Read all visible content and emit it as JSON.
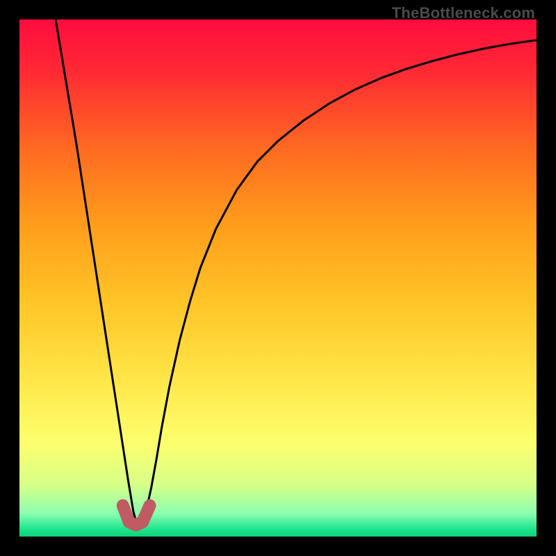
{
  "watermark": "TheBottleneck.com",
  "chart_data": {
    "type": "line",
    "title": "",
    "xlabel": "",
    "ylabel": "",
    "xlim": [
      0,
      1
    ],
    "ylim": [
      0,
      1
    ],
    "gradient_stops": [
      {
        "pos": 0.0,
        "color": "#ff0c3e"
      },
      {
        "pos": 0.1,
        "color": "#ff2934"
      },
      {
        "pos": 0.25,
        "color": "#ff6a21"
      },
      {
        "pos": 0.4,
        "color": "#ff9e1c"
      },
      {
        "pos": 0.55,
        "color": "#ffc527"
      },
      {
        "pos": 0.7,
        "color": "#ffe74a"
      },
      {
        "pos": 0.82,
        "color": "#fcff6e"
      },
      {
        "pos": 0.9,
        "color": "#d7ff88"
      },
      {
        "pos": 0.955,
        "color": "#8cffb0"
      },
      {
        "pos": 0.985,
        "color": "#20e58f"
      },
      {
        "pos": 1.0,
        "color": "#0ad279"
      }
    ],
    "series": [
      {
        "name": "curve",
        "stroke": "#000000",
        "stroke_width": 3,
        "x": [
          0.07,
          0.08,
          0.09,
          0.1,
          0.11,
          0.12,
          0.13,
          0.14,
          0.15,
          0.16,
          0.17,
          0.18,
          0.19,
          0.2,
          0.21,
          0.22,
          0.225,
          0.235,
          0.245,
          0.255,
          0.265,
          0.275,
          0.29,
          0.31,
          0.33,
          0.35,
          0.38,
          0.42,
          0.46,
          0.5,
          0.55,
          0.6,
          0.65,
          0.7,
          0.75,
          0.8,
          0.85,
          0.9,
          0.95,
          1.0
        ],
        "y": [
          1.0,
          0.94,
          0.88,
          0.82,
          0.76,
          0.695,
          0.63,
          0.565,
          0.5,
          0.435,
          0.37,
          0.305,
          0.24,
          0.175,
          0.11,
          0.05,
          0.03,
          0.03,
          0.05,
          0.095,
          0.15,
          0.21,
          0.29,
          0.38,
          0.455,
          0.52,
          0.595,
          0.67,
          0.725,
          0.765,
          0.805,
          0.838,
          0.865,
          0.887,
          0.905,
          0.92,
          0.933,
          0.944,
          0.953,
          0.96
        ]
      }
    ],
    "marker": {
      "name": "u-marker",
      "stroke": "#c05a63",
      "stroke_width": 18,
      "linecap": "round",
      "x": [
        0.2,
        0.212,
        0.225,
        0.238,
        0.252
      ],
      "y": [
        0.06,
        0.028,
        0.022,
        0.028,
        0.06
      ]
    }
  }
}
